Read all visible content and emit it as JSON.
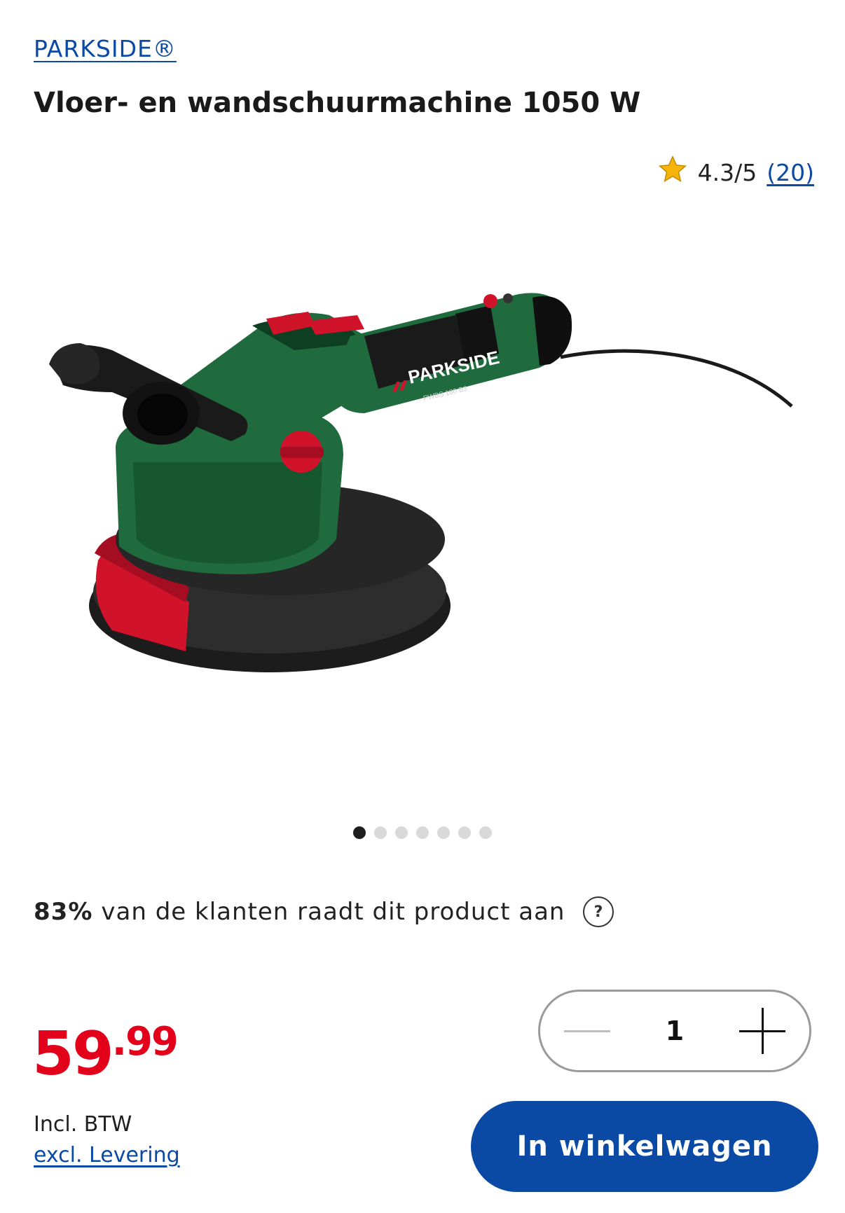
{
  "header": {
    "brand": "PARKSIDE®",
    "title": "Vloer- en wandschuurmachine 1050 W"
  },
  "rating": {
    "score": "4.3/5",
    "count": "(20)"
  },
  "product_image": {
    "brand_text": "PARKSIDE",
    "model_text": "PWBS 180 B3"
  },
  "carousel": {
    "total": 7,
    "active": 1
  },
  "recommendation": {
    "percent": "83%",
    "text": "van de klanten raadt dit product aan",
    "help_icon": "?"
  },
  "price": {
    "integer": "59",
    "decimal": ".99",
    "vat_label": "Incl. BTW",
    "delivery_link": "excl. Levering"
  },
  "quantity": {
    "value": "1"
  },
  "cart_button": {
    "label": "In winkelwagen"
  },
  "colors": {
    "brand_blue": "#0a4aa5",
    "price_red": "#e3001b",
    "star": "#f5b40a"
  }
}
